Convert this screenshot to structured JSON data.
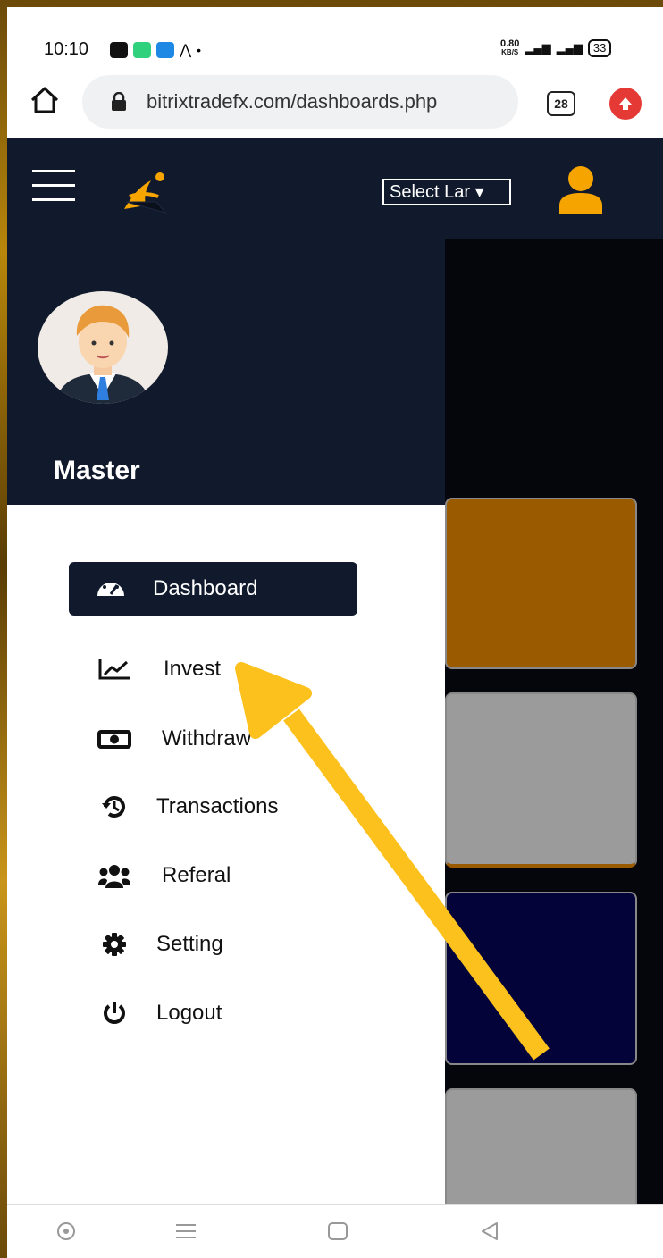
{
  "status_bar": {
    "time": "10:10",
    "speed_value": "0.80",
    "speed_unit": "KB/S",
    "battery": "33"
  },
  "browser": {
    "url": "bitrixtradefx.com/dashboards.php",
    "tab_count": "28"
  },
  "header": {
    "language_select": "Select Lar ▾"
  },
  "sidebar": {
    "username": "Master",
    "items": [
      {
        "label": "Dashboard",
        "icon": "gauge-icon",
        "active": true
      },
      {
        "label": "Invest",
        "icon": "chart-line-icon"
      },
      {
        "label": "Withdraw",
        "icon": "money-bill-icon"
      },
      {
        "label": "Transactions",
        "icon": "history-icon"
      },
      {
        "label": "Referal",
        "icon": "users-icon"
      },
      {
        "label": "Setting",
        "icon": "gear-icon"
      },
      {
        "label": "Logout",
        "icon": "power-icon"
      }
    ]
  },
  "colors": {
    "header_bg": "#111a2c",
    "accent": "#f5a400",
    "card_orange": "#9a5b00",
    "card_gray": "#9b9b9b",
    "card_navy": "#03033a",
    "annotation_arrow": "#fcc11d"
  }
}
